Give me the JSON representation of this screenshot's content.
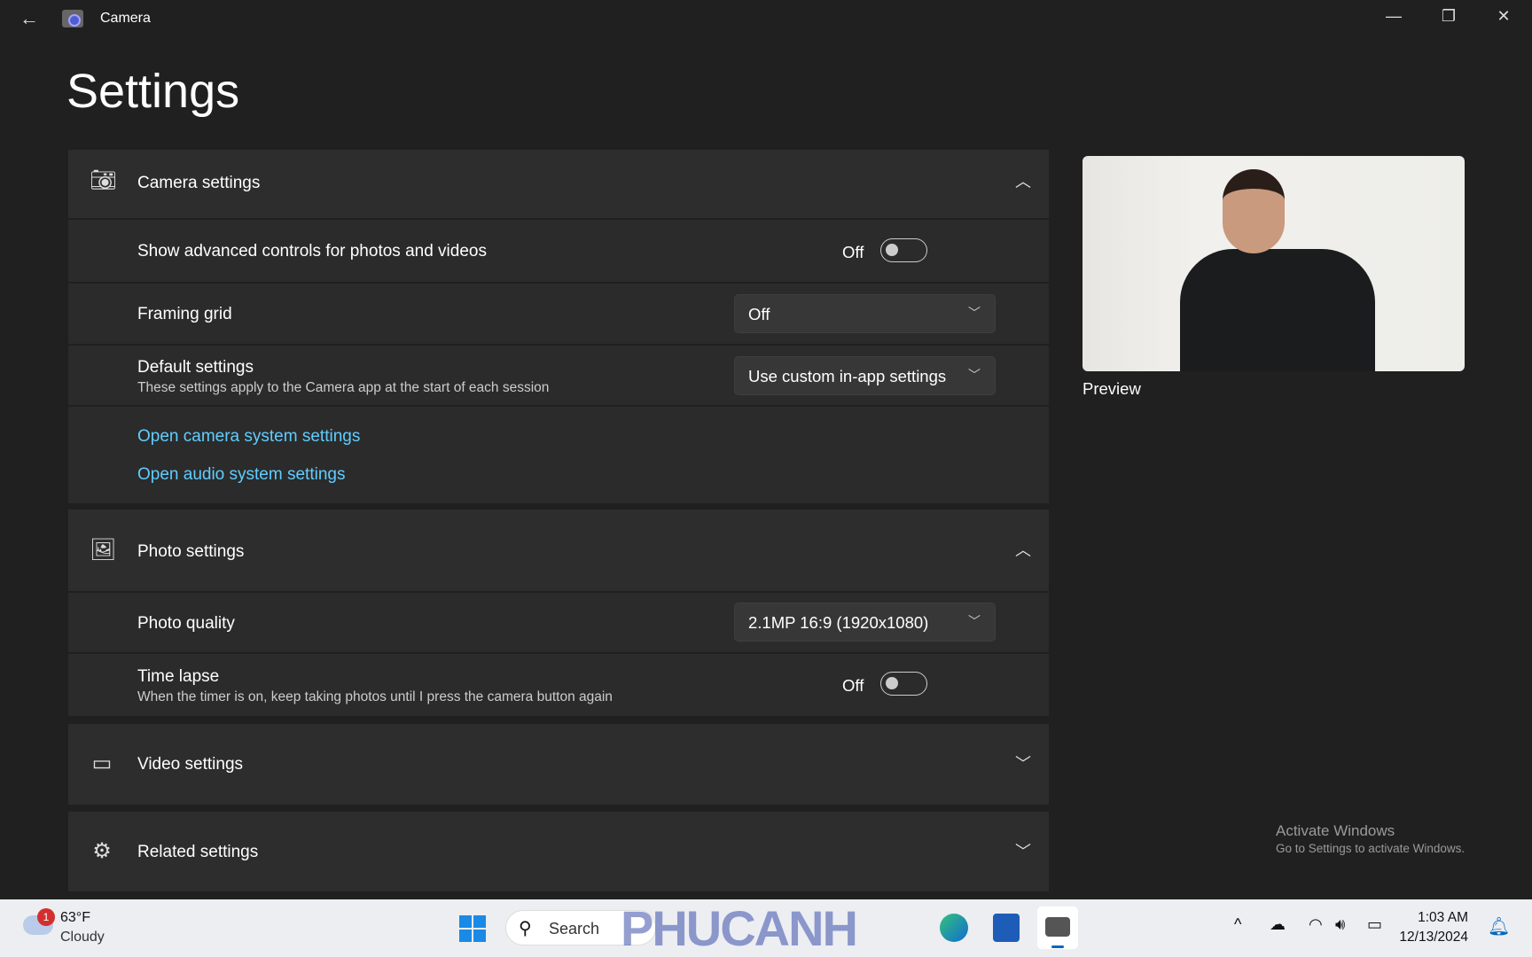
{
  "window": {
    "title": "Camera",
    "back": "←",
    "minimize": "—",
    "maximize": "❐",
    "close": "✕"
  },
  "page": {
    "title": "Settings"
  },
  "camera_settings": {
    "title": "Camera settings",
    "advanced": {
      "label": "Show advanced controls for photos and videos",
      "state": "Off"
    },
    "framing": {
      "label": "Framing grid",
      "value": "Off"
    },
    "default": {
      "label": "Default settings",
      "desc": "These settings apply to the Camera app at the start of each session",
      "value": "Use custom in-app settings"
    },
    "link_camera": "Open camera system settings",
    "link_audio": "Open audio system settings"
  },
  "photo_settings": {
    "title": "Photo settings",
    "quality": {
      "label": "Photo quality",
      "value": "2.1MP 16:9 (1920x1080)"
    },
    "timelapse": {
      "label": "Time lapse",
      "desc": "When the timer is on, keep taking photos until I press the camera button again",
      "state": "Off"
    }
  },
  "video_settings": {
    "title": "Video settings"
  },
  "related_settings": {
    "title": "Related settings"
  },
  "preview": {
    "label": "Preview"
  },
  "activation": {
    "title": "Activate Windows",
    "desc": "Go to Settings to activate Windows."
  },
  "taskbar": {
    "weather_temp": "63°F",
    "weather_desc": "Cloudy",
    "weather_badge": "1",
    "search": "Search",
    "time": "1:03 AM",
    "date": "12/13/2024",
    "watermark": "PHUCANH"
  },
  "colors": {
    "link": "#60cdff",
    "background": "#202020",
    "card": "#2b2b2b"
  }
}
